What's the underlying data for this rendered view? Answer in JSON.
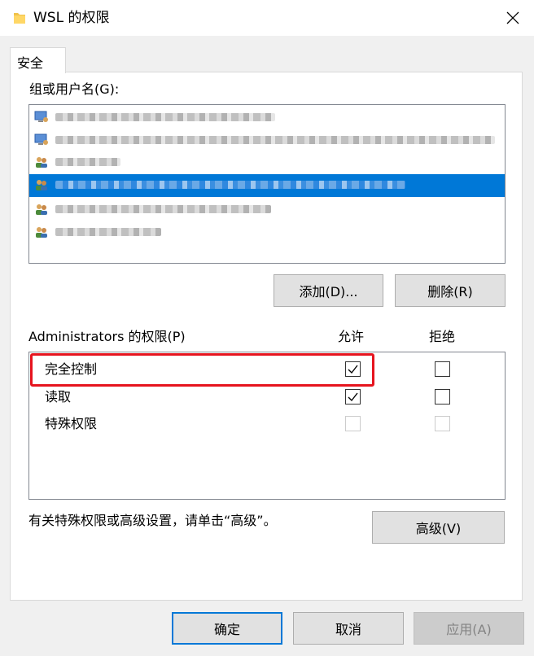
{
  "window": {
    "title": "WSL 的权限",
    "close_glyph": "✕"
  },
  "tabs": [
    {
      "label": "安全",
      "selected": true
    }
  ],
  "groups": {
    "label": "组或用户名(G):",
    "items": [
      {
        "icon": "computer-user-icon",
        "selected": false
      },
      {
        "icon": "computer-user-icon",
        "selected": false
      },
      {
        "icon": "user-group-icon",
        "selected": false
      },
      {
        "icon": "user-group-icon",
        "selected": true
      },
      {
        "icon": "user-group-icon",
        "selected": false
      },
      {
        "icon": "user-group-icon",
        "selected": false
      }
    ],
    "add_label": "添加(D)...",
    "remove_label": "删除(R)"
  },
  "permissions": {
    "label": "Administrators 的权限(P)",
    "allow_header": "允许",
    "deny_header": "拒绝",
    "rows": [
      {
        "name": "完全控制",
        "allow": true,
        "deny": false,
        "enabled": true
      },
      {
        "name": "读取",
        "allow": true,
        "deny": false,
        "enabled": true
      },
      {
        "name": "特殊权限",
        "allow": false,
        "deny": false,
        "enabled": false
      }
    ]
  },
  "advanced": {
    "hint": "有关特殊权限或高级设置，请单击“高级”。",
    "button_label": "高级(V)"
  },
  "footer": {
    "ok_label": "确定",
    "cancel_label": "取消",
    "apply_label": "应用(A)"
  },
  "colors": {
    "selection": "#0078d7",
    "highlight": "#e6141e",
    "primary_border": "#0078d7"
  }
}
